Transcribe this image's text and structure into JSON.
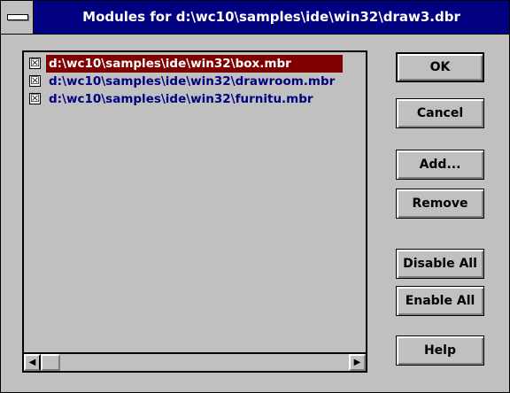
{
  "window": {
    "title": "Modules for d:\\wc10\\samples\\ide\\win32\\draw3.dbr"
  },
  "modules": [
    {
      "checked": "☒",
      "path": "d:\\wc10\\samples\\ide\\win32\\box.mbr",
      "selected": true
    },
    {
      "checked": "☒",
      "path": "d:\\wc10\\samples\\ide\\win32\\drawroom.mbr",
      "selected": false
    },
    {
      "checked": "☒",
      "path": "d:\\wc10\\samples\\ide\\win32\\furnitu.mbr",
      "selected": false
    }
  ],
  "scrollbar": {
    "left_arrow": "◀",
    "right_arrow": "▶"
  },
  "buttons": {
    "ok": "OK",
    "cancel": "Cancel",
    "add": "Add...",
    "remove": "Remove",
    "disable_all": "Disable All",
    "enable_all": "Enable All",
    "help": "Help"
  },
  "icons": {
    "system_menu": "system-menu-icon",
    "checkbox": "checkbox-checked-icon",
    "scroll_left": "arrow-left-icon",
    "scroll_right": "arrow-right-icon"
  },
  "colors": {
    "titlebar": "#000080",
    "selection": "#800000",
    "item_text": "#000080",
    "face": "#c0c0c0"
  }
}
